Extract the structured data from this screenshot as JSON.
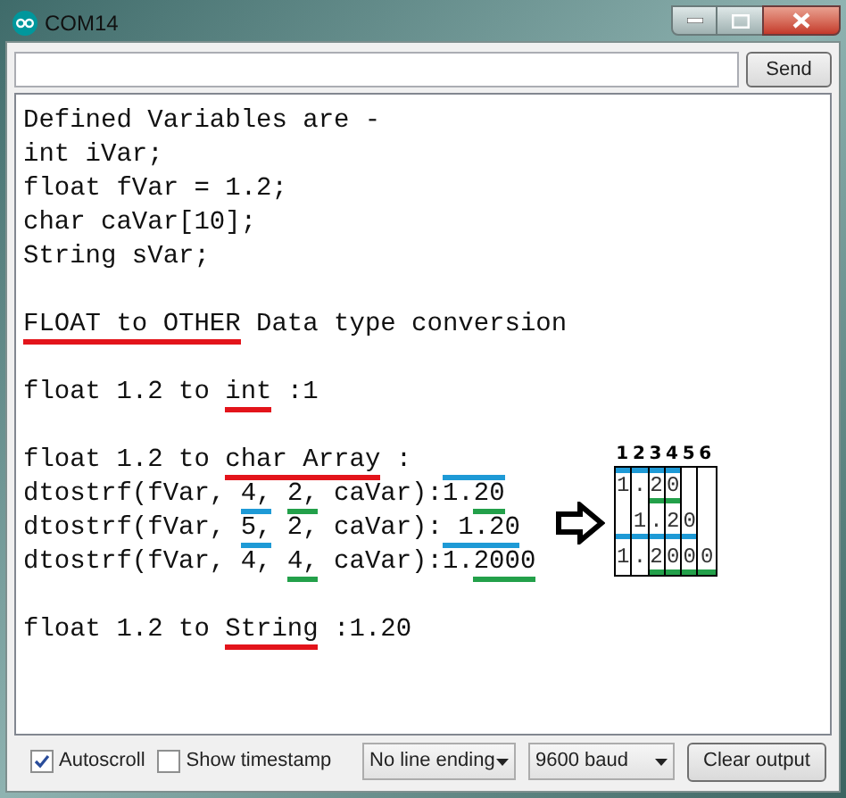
{
  "window": {
    "title": "COM14"
  },
  "send_button": "Send",
  "output": {
    "lines": [
      {
        "kind": "text",
        "segments": [
          {
            "text": "Defined Variables are -"
          }
        ]
      },
      {
        "kind": "text",
        "segments": [
          {
            "text": "int iVar;"
          }
        ]
      },
      {
        "kind": "text",
        "segments": [
          {
            "text": "float fVar = 1.2;"
          }
        ]
      },
      {
        "kind": "text",
        "segments": [
          {
            "text": "char caVar[10];"
          }
        ]
      },
      {
        "kind": "text",
        "segments": [
          {
            "text": "String sVar;"
          }
        ]
      },
      {
        "kind": "blank"
      },
      {
        "kind": "text",
        "segments": [
          {
            "text": "FLOAT to OTHER",
            "marks": [
              {
                "kind": "underline",
                "color": "#e3141b"
              }
            ]
          },
          {
            "text": " Data type conversion"
          }
        ]
      },
      {
        "kind": "blank"
      },
      {
        "kind": "text",
        "segments": [
          {
            "text": "float 1.2 to "
          },
          {
            "text": "int",
            "marks": [
              {
                "kind": "underline",
                "color": "#e3141b"
              }
            ]
          },
          {
            "text": " :1"
          }
        ]
      },
      {
        "kind": "blank"
      },
      {
        "kind": "text",
        "segments": [
          {
            "text": "float 1.2 to "
          },
          {
            "text": "char Array",
            "marks": [
              {
                "kind": "underline",
                "color": "#e3141b"
              }
            ]
          },
          {
            "text": " :"
          }
        ]
      },
      {
        "kind": "text",
        "segments": [
          {
            "text": "dtostrf(fVar, "
          },
          {
            "text": "4,",
            "marks": [
              {
                "kind": "underline",
                "color": "#1e9ad6"
              }
            ]
          },
          {
            "text": " 2,",
            "skip_lead": true,
            "marks": [
              {
                "kind": "underline",
                "color": "#23a04a"
              }
            ]
          },
          {
            "text": " caVar):"
          },
          {
            "text": "1.",
            "marks": [
              {
                "kind": "overline",
                "color": "#1e9ad6"
              }
            ]
          },
          {
            "text": "20",
            "marks": [
              {
                "kind": "overline",
                "color": "#1e9ad6"
              },
              {
                "kind": "underline",
                "color": "#23a04a"
              }
            ]
          }
        ]
      },
      {
        "kind": "text",
        "segments": [
          {
            "text": "dtostrf(fVar, "
          },
          {
            "text": "5,",
            "marks": [
              {
                "kind": "underline",
                "color": "#1e9ad6"
              }
            ]
          },
          {
            "text": " 2, caVar):"
          },
          {
            "text": " 1.20",
            "marks": [
              {
                "kind": "underline",
                "color": "#1e9ad6"
              }
            ]
          }
        ]
      },
      {
        "kind": "text",
        "segments": [
          {
            "text": "dtostrf(fVar, 4, "
          },
          {
            "text": "4,",
            "marks": [
              {
                "kind": "underline",
                "color": "#23a04a"
              }
            ]
          },
          {
            "text": " caVar):1."
          },
          {
            "text": "2000",
            "marks": [
              {
                "kind": "underline",
                "color": "#23a04a"
              }
            ]
          }
        ]
      },
      {
        "kind": "blank"
      },
      {
        "kind": "text",
        "segments": [
          {
            "text": "float 1.2 to "
          },
          {
            "text": "String",
            "marks": [
              {
                "kind": "underline",
                "color": "#e3141b"
              }
            ]
          },
          {
            "text": " :1.20"
          }
        ]
      }
    ]
  },
  "grid": {
    "columns": [
      "1",
      "2",
      "3",
      "4",
      "5",
      "6"
    ],
    "rows": [
      [
        {
          "text": "1",
          "marks": [
            {
              "kind": "top",
              "color": "#1e9ad6"
            }
          ]
        },
        {
          "text": ".",
          "marks": [
            {
              "kind": "top",
              "color": "#1e9ad6"
            }
          ]
        },
        {
          "text": "2",
          "marks": [
            {
              "kind": "top",
              "color": "#1e9ad6"
            },
            {
              "kind": "bottom",
              "color": "#23a04a"
            }
          ]
        },
        {
          "text": "0",
          "marks": [
            {
              "kind": "top",
              "color": "#1e9ad6"
            },
            {
              "kind": "bottom",
              "color": "#23a04a"
            }
          ]
        },
        {},
        {}
      ],
      [
        {
          "marks": [
            {
              "kind": "bottom",
              "color": "#1e9ad6"
            }
          ]
        },
        {
          "text": "1",
          "marks": [
            {
              "kind": "bottom",
              "color": "#1e9ad6"
            }
          ]
        },
        {
          "text": ".",
          "marks": [
            {
              "kind": "bottom",
              "color": "#1e9ad6"
            }
          ]
        },
        {
          "text": "2",
          "marks": [
            {
              "kind": "bottom",
              "color": "#1e9ad6"
            }
          ]
        },
        {
          "text": "0",
          "marks": [
            {
              "kind": "bottom",
              "color": "#1e9ad6"
            }
          ]
        },
        {}
      ],
      [
        {
          "text": "1"
        },
        {
          "text": "."
        },
        {
          "text": "2",
          "marks": [
            {
              "kind": "bottom",
              "color": "#23a04a"
            }
          ]
        },
        {
          "text": "0",
          "marks": [
            {
              "kind": "bottom",
              "color": "#23a04a"
            }
          ]
        },
        {
          "text": "0",
          "marks": [
            {
              "kind": "bottom",
              "color": "#23a04a"
            }
          ]
        },
        {
          "text": "0",
          "marks": [
            {
              "kind": "bottom",
              "color": "#23a04a"
            }
          ]
        }
      ]
    ]
  },
  "footer": {
    "autoscroll": {
      "label": "Autoscroll",
      "checked": true
    },
    "timestamp": {
      "label": "Show timestamp",
      "checked": false
    },
    "line_ending": "No line ending",
    "baud": "9600 baud",
    "clear_button": "Clear output"
  }
}
